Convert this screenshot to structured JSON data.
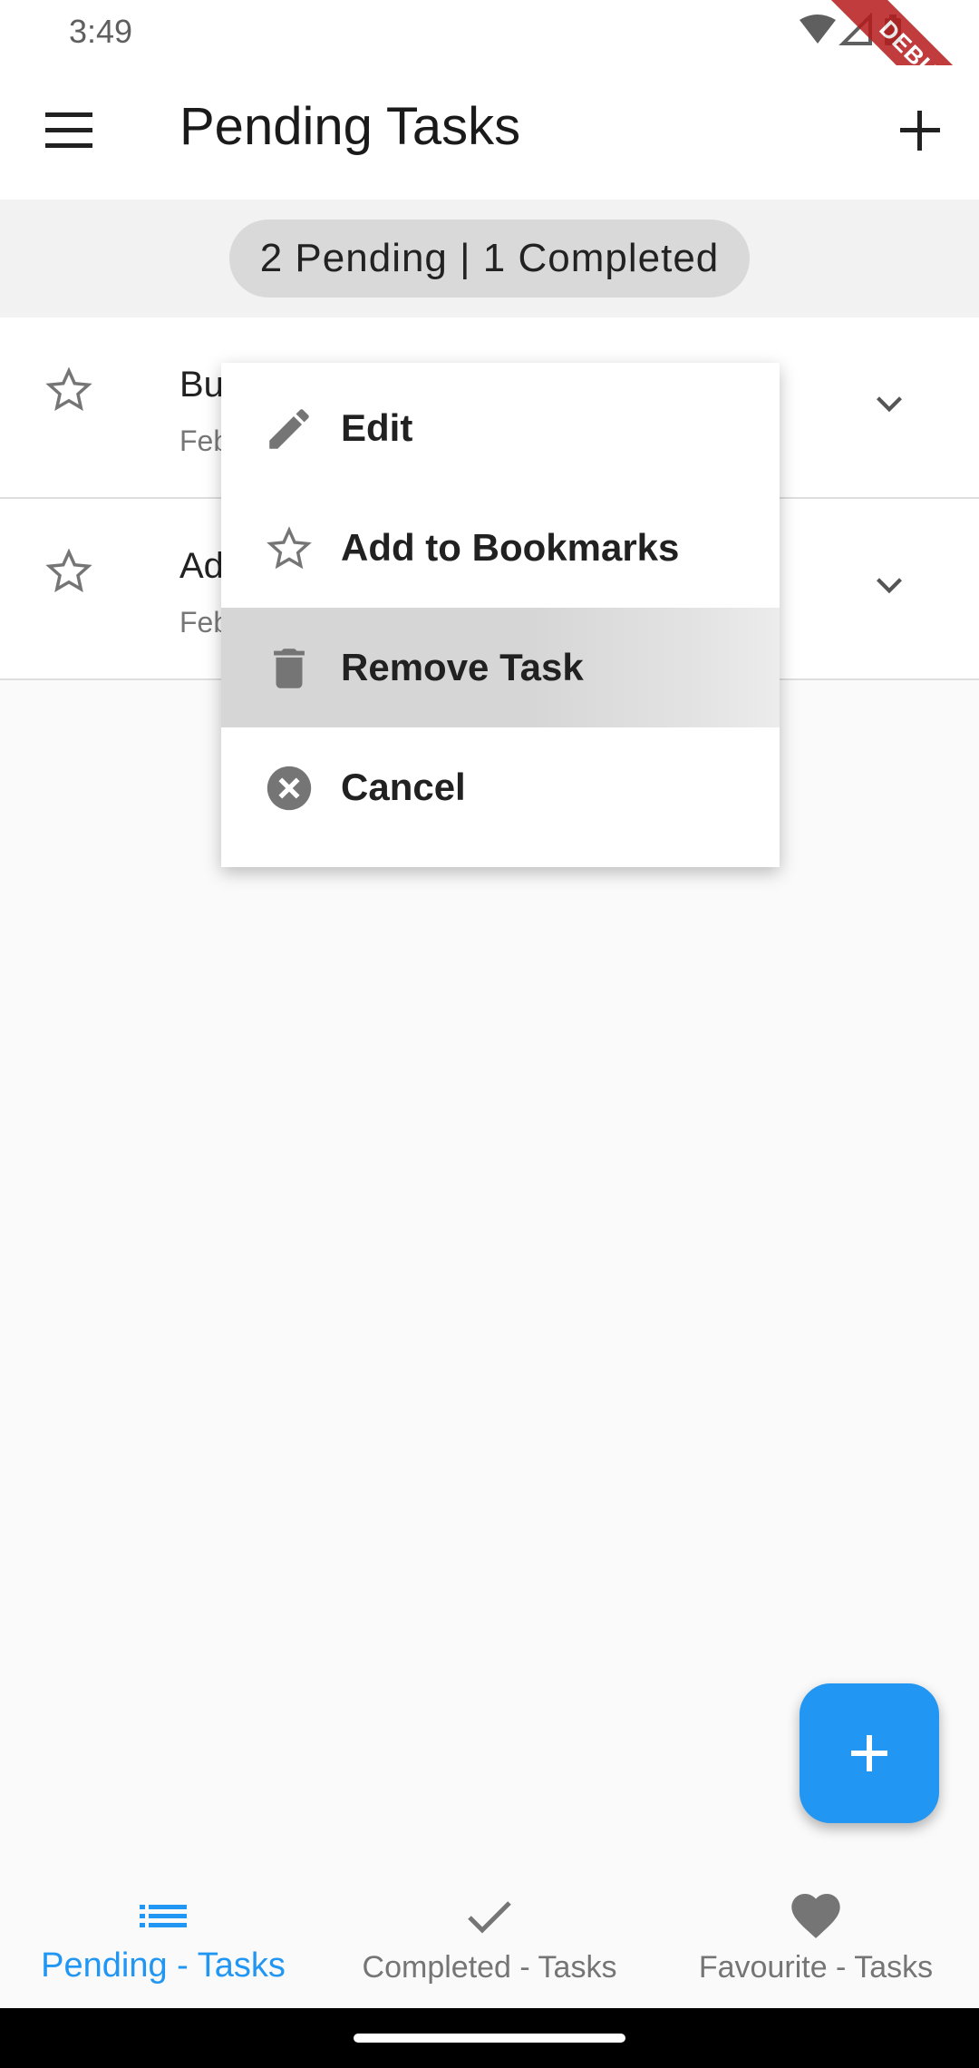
{
  "status_bar": {
    "time": "3:49",
    "debug_label": "DEBUG"
  },
  "app_bar": {
    "title": "Pending Tasks",
    "menu_icon": "hamburger-menu-icon",
    "add_icon": "add-icon"
  },
  "summary": {
    "text": "2 Pending | 1 Completed"
  },
  "tasks": [
    {
      "title": "Bu",
      "date": "Feb",
      "starred": false
    },
    {
      "title": "Ad",
      "date": "Feb",
      "starred": false
    }
  ],
  "context_menu": {
    "items": [
      {
        "label": "Edit",
        "icon": "pencil-icon"
      },
      {
        "label": "Add to Bookmarks",
        "icon": "star-outline-icon"
      },
      {
        "label": "Remove Task",
        "icon": "trash-icon",
        "highlighted": true
      },
      {
        "label": "Cancel",
        "icon": "cancel-circle-icon"
      }
    ]
  },
  "fab": {
    "icon": "plus-icon",
    "color": "#2196f3"
  },
  "bottom_nav": {
    "items": [
      {
        "label": "Pending - Tasks",
        "icon": "list-icon",
        "active": true
      },
      {
        "label": "Completed - Tasks",
        "icon": "check-icon",
        "active": false
      },
      {
        "label": "Favourite - Tasks",
        "icon": "heart-icon",
        "active": false
      }
    ]
  },
  "colors": {
    "accent": "#2196f3",
    "icon_gray": "#757575",
    "highlight": "#d6d6d6"
  }
}
